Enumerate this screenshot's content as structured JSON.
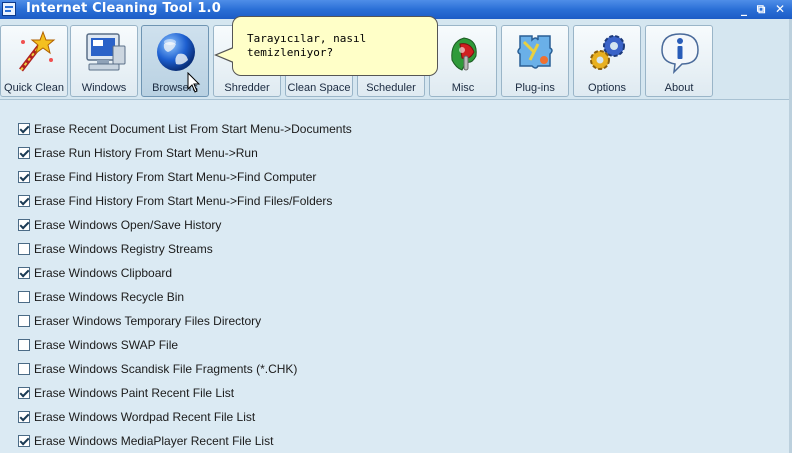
{
  "window": {
    "title": "Internet Cleaning Tool 1.0",
    "controls": [
      "_",
      "⧉",
      "✕"
    ]
  },
  "toolbar": {
    "buttons": [
      {
        "label": "Quick Clean",
        "icon": "magic-wand-icon"
      },
      {
        "label": "Windows",
        "icon": "computer-monitor-icon"
      },
      {
        "label": "Browsers",
        "icon": "globe-icon"
      },
      {
        "label": "Shredder",
        "icon": "shredder-icon"
      },
      {
        "label": "Clean Space",
        "icon": "disk-icon"
      },
      {
        "label": "Scheduler",
        "icon": "clock-icon"
      },
      {
        "label": "Misc",
        "icon": "tools-icon"
      },
      {
        "label": "Plug-ins",
        "icon": "puzzle-icon"
      },
      {
        "label": "Options",
        "icon": "gears-icon"
      },
      {
        "label": "About",
        "icon": "info-bubble-icon"
      }
    ]
  },
  "tooltip": {
    "line1": "Tarayıcılar, nasıl",
    "line2": "temizleniyor?"
  },
  "options": [
    {
      "label": "Erase Recent Document List From Start Menu->Documents",
      "checked": true
    },
    {
      "label": "Erase Run History From Start Menu->Run",
      "checked": true
    },
    {
      "label": "Erase Find History From Start Menu->Find Computer",
      "checked": true
    },
    {
      "label": "Erase Find History From Start Menu->Find Files/Folders",
      "checked": true
    },
    {
      "label": "Erase Windows Open/Save History",
      "checked": true
    },
    {
      "label": "Erase Windows Registry Streams",
      "checked": false
    },
    {
      "label": "Erase Windows Clipboard",
      "checked": true
    },
    {
      "label": "Erase Windows Recycle Bin",
      "checked": false
    },
    {
      "label": "Eraser Windows Temporary Files Directory",
      "checked": false
    },
    {
      "label": "Erase Windows SWAP File",
      "checked": false
    },
    {
      "label": "Erase Windows Scandisk File Fragments (*.CHK)",
      "checked": false
    },
    {
      "label": "Erase Windows Paint Recent File List",
      "checked": true
    },
    {
      "label": "Erase Windows Wordpad Recent File List",
      "checked": true
    },
    {
      "label": "Erase Windows MediaPlayer Recent File List",
      "checked": true
    }
  ]
}
